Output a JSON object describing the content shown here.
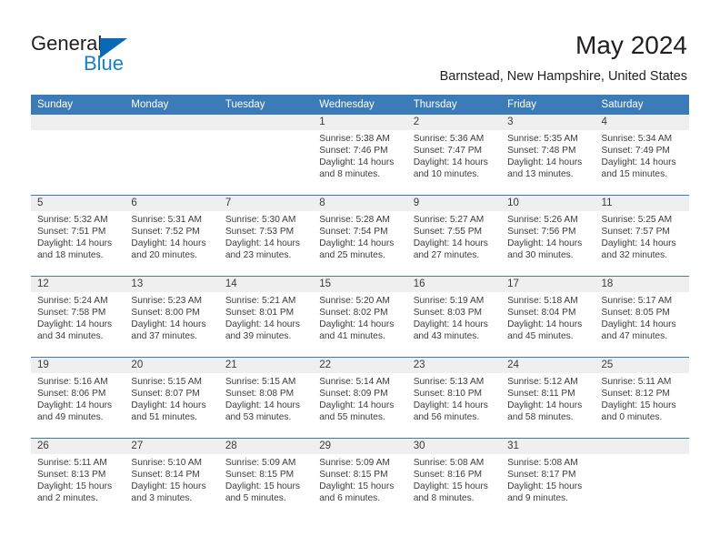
{
  "brand": {
    "name_part1": "General",
    "name_part2": "Blue",
    "triangle_color": "#0a6ab5",
    "blue_color": "#1581c9"
  },
  "header": {
    "title": "May 2024",
    "subtitle": "Barnstead, New Hampshire, United States"
  },
  "theme": {
    "header_blue": "#3b7cb8",
    "date_strip_gray": "#efefef",
    "text_color": "#3c3c3c"
  },
  "weekdays": [
    "Sunday",
    "Monday",
    "Tuesday",
    "Wednesday",
    "Thursday",
    "Friday",
    "Saturday"
  ],
  "weeks": [
    [
      {
        "date": "",
        "empty": true
      },
      {
        "date": "",
        "empty": true
      },
      {
        "date": "",
        "empty": true
      },
      {
        "date": "1",
        "sunrise": "Sunrise: 5:38 AM",
        "sunset": "Sunset: 7:46 PM",
        "daylight": "Daylight: 14 hours and 8 minutes."
      },
      {
        "date": "2",
        "sunrise": "Sunrise: 5:36 AM",
        "sunset": "Sunset: 7:47 PM",
        "daylight": "Daylight: 14 hours and 10 minutes."
      },
      {
        "date": "3",
        "sunrise": "Sunrise: 5:35 AM",
        "sunset": "Sunset: 7:48 PM",
        "daylight": "Daylight: 14 hours and 13 minutes."
      },
      {
        "date": "4",
        "sunrise": "Sunrise: 5:34 AM",
        "sunset": "Sunset: 7:49 PM",
        "daylight": "Daylight: 14 hours and 15 minutes."
      }
    ],
    [
      {
        "date": "5",
        "sunrise": "Sunrise: 5:32 AM",
        "sunset": "Sunset: 7:51 PM",
        "daylight": "Daylight: 14 hours and 18 minutes."
      },
      {
        "date": "6",
        "sunrise": "Sunrise: 5:31 AM",
        "sunset": "Sunset: 7:52 PM",
        "daylight": "Daylight: 14 hours and 20 minutes."
      },
      {
        "date": "7",
        "sunrise": "Sunrise: 5:30 AM",
        "sunset": "Sunset: 7:53 PM",
        "daylight": "Daylight: 14 hours and 23 minutes."
      },
      {
        "date": "8",
        "sunrise": "Sunrise: 5:28 AM",
        "sunset": "Sunset: 7:54 PM",
        "daylight": "Daylight: 14 hours and 25 minutes."
      },
      {
        "date": "9",
        "sunrise": "Sunrise: 5:27 AM",
        "sunset": "Sunset: 7:55 PM",
        "daylight": "Daylight: 14 hours and 27 minutes."
      },
      {
        "date": "10",
        "sunrise": "Sunrise: 5:26 AM",
        "sunset": "Sunset: 7:56 PM",
        "daylight": "Daylight: 14 hours and 30 minutes."
      },
      {
        "date": "11",
        "sunrise": "Sunrise: 5:25 AM",
        "sunset": "Sunset: 7:57 PM",
        "daylight": "Daylight: 14 hours and 32 minutes."
      }
    ],
    [
      {
        "date": "12",
        "sunrise": "Sunrise: 5:24 AM",
        "sunset": "Sunset: 7:58 PM",
        "daylight": "Daylight: 14 hours and 34 minutes."
      },
      {
        "date": "13",
        "sunrise": "Sunrise: 5:23 AM",
        "sunset": "Sunset: 8:00 PM",
        "daylight": "Daylight: 14 hours and 37 minutes."
      },
      {
        "date": "14",
        "sunrise": "Sunrise: 5:21 AM",
        "sunset": "Sunset: 8:01 PM",
        "daylight": "Daylight: 14 hours and 39 minutes."
      },
      {
        "date": "15",
        "sunrise": "Sunrise: 5:20 AM",
        "sunset": "Sunset: 8:02 PM",
        "daylight": "Daylight: 14 hours and 41 minutes."
      },
      {
        "date": "16",
        "sunrise": "Sunrise: 5:19 AM",
        "sunset": "Sunset: 8:03 PM",
        "daylight": "Daylight: 14 hours and 43 minutes."
      },
      {
        "date": "17",
        "sunrise": "Sunrise: 5:18 AM",
        "sunset": "Sunset: 8:04 PM",
        "daylight": "Daylight: 14 hours and 45 minutes."
      },
      {
        "date": "18",
        "sunrise": "Sunrise: 5:17 AM",
        "sunset": "Sunset: 8:05 PM",
        "daylight": "Daylight: 14 hours and 47 minutes."
      }
    ],
    [
      {
        "date": "19",
        "sunrise": "Sunrise: 5:16 AM",
        "sunset": "Sunset: 8:06 PM",
        "daylight": "Daylight: 14 hours and 49 minutes."
      },
      {
        "date": "20",
        "sunrise": "Sunrise: 5:15 AM",
        "sunset": "Sunset: 8:07 PM",
        "daylight": "Daylight: 14 hours and 51 minutes."
      },
      {
        "date": "21",
        "sunrise": "Sunrise: 5:15 AM",
        "sunset": "Sunset: 8:08 PM",
        "daylight": "Daylight: 14 hours and 53 minutes."
      },
      {
        "date": "22",
        "sunrise": "Sunrise: 5:14 AM",
        "sunset": "Sunset: 8:09 PM",
        "daylight": "Daylight: 14 hours and 55 minutes."
      },
      {
        "date": "23",
        "sunrise": "Sunrise: 5:13 AM",
        "sunset": "Sunset: 8:10 PM",
        "daylight": "Daylight: 14 hours and 56 minutes."
      },
      {
        "date": "24",
        "sunrise": "Sunrise: 5:12 AM",
        "sunset": "Sunset: 8:11 PM",
        "daylight": "Daylight: 14 hours and 58 minutes."
      },
      {
        "date": "25",
        "sunrise": "Sunrise: 5:11 AM",
        "sunset": "Sunset: 8:12 PM",
        "daylight": "Daylight: 15 hours and 0 minutes."
      }
    ],
    [
      {
        "date": "26",
        "sunrise": "Sunrise: 5:11 AM",
        "sunset": "Sunset: 8:13 PM",
        "daylight": "Daylight: 15 hours and 2 minutes."
      },
      {
        "date": "27",
        "sunrise": "Sunrise: 5:10 AM",
        "sunset": "Sunset: 8:14 PM",
        "daylight": "Daylight: 15 hours and 3 minutes."
      },
      {
        "date": "28",
        "sunrise": "Sunrise: 5:09 AM",
        "sunset": "Sunset: 8:15 PM",
        "daylight": "Daylight: 15 hours and 5 minutes."
      },
      {
        "date": "29",
        "sunrise": "Sunrise: 5:09 AM",
        "sunset": "Sunset: 8:15 PM",
        "daylight": "Daylight: 15 hours and 6 minutes."
      },
      {
        "date": "30",
        "sunrise": "Sunrise: 5:08 AM",
        "sunset": "Sunset: 8:16 PM",
        "daylight": "Daylight: 15 hours and 8 minutes."
      },
      {
        "date": "31",
        "sunrise": "Sunrise: 5:08 AM",
        "sunset": "Sunset: 8:17 PM",
        "daylight": "Daylight: 15 hours and 9 minutes."
      },
      {
        "date": "",
        "empty": true
      }
    ]
  ]
}
